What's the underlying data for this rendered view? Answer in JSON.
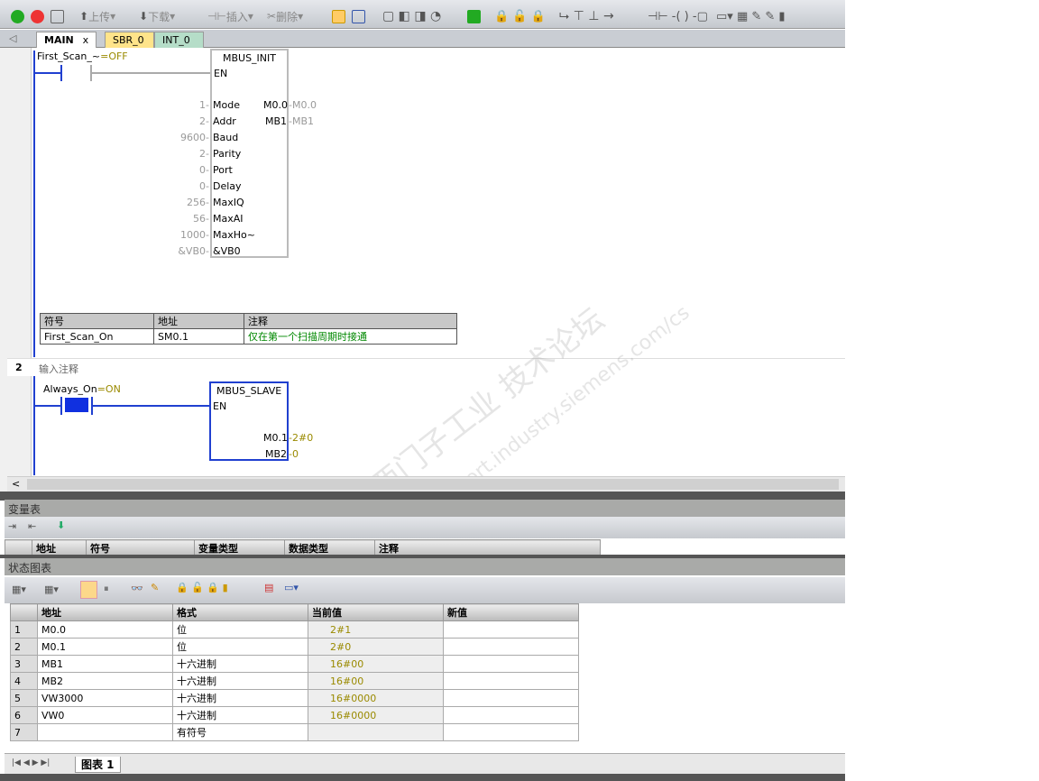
{
  "toolbar": {
    "upload": "上传",
    "download": "下载",
    "insert": "插入",
    "delete": "删除"
  },
  "tabs": [
    {
      "label": "MAIN",
      "close": "x"
    },
    {
      "label": "SBR_0"
    },
    {
      "label": "INT_0"
    }
  ],
  "network1": {
    "contact_label": "First_Scan_~",
    "contact_state": "=OFF",
    "block": {
      "title": "MBUS_INIT",
      "en": "EN",
      "inputs": [
        {
          "value": "1",
          "pin": "Mode"
        },
        {
          "value": "2",
          "pin": "Addr"
        },
        {
          "value": "9600",
          "pin": "Baud"
        },
        {
          "value": "2",
          "pin": "Parity"
        },
        {
          "value": "0",
          "pin": "Port"
        },
        {
          "value": "0",
          "pin": "Delay"
        },
        {
          "value": "256",
          "pin": "MaxIQ"
        },
        {
          "value": "56",
          "pin": "MaxAI"
        },
        {
          "value": "1000",
          "pin": "MaxHo~"
        },
        {
          "value": "&VB0",
          "pin": "&VB0"
        }
      ],
      "outputs": [
        {
          "pin": "M0.0",
          "value": "M0.0"
        },
        {
          "pin": "MB1",
          "value": "MB1"
        }
      ]
    },
    "symbol_table": {
      "headers": [
        "符号",
        "地址",
        "注释"
      ],
      "row": [
        "First_Scan_On",
        "SM0.1",
        "仅在第一个扫描周期时接通"
      ]
    }
  },
  "network2": {
    "number": "2",
    "comment": "输入注释",
    "contact_label": "Always_On",
    "contact_state": "=ON",
    "block": {
      "title": "MBUS_SLAVE",
      "en": "EN",
      "outputs": [
        {
          "pin": "M0.1",
          "value": "2#0"
        },
        {
          "pin": "MB2",
          "value": "0"
        }
      ]
    }
  },
  "watermark": {
    "line1": "西门子工业 技术论坛",
    "line2": "support.industry.siemens.com/cs"
  },
  "var_table": {
    "title": "变量表",
    "headers": [
      "地址",
      "符号",
      "变量类型",
      "数据类型",
      "注释"
    ]
  },
  "status_chart": {
    "title": "状态图表",
    "headers": [
      "地址",
      "格式",
      "当前值",
      "新值"
    ],
    "rows": [
      [
        "1",
        "M0.0",
        "位",
        "2#1",
        ""
      ],
      [
        "2",
        "M0.1",
        "位",
        "2#0",
        ""
      ],
      [
        "3",
        "MB1",
        "十六进制",
        "16#00",
        ""
      ],
      [
        "4",
        "MB2",
        "十六进制",
        "16#00",
        ""
      ],
      [
        "5",
        "VW3000",
        "十六进制",
        "16#0000",
        ""
      ],
      [
        "6",
        "VW0",
        "十六进制",
        "16#0000",
        ""
      ],
      [
        "7",
        "",
        "有符号",
        "",
        ""
      ]
    ],
    "sheet_tab": "图表 1"
  },
  "scroll_left": "<"
}
